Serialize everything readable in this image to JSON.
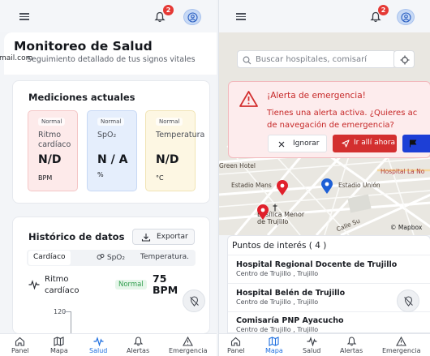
{
  "topbar": {
    "notification_count": "2"
  },
  "screen_a": {
    "page_title": "Monitoreo de Salud",
    "subtitle": "Seguimiento detallado de tus signos vitales",
    "email_fragment": "mail.com",
    "current_measurements": {
      "title": "Mediciones actuales",
      "metrics": [
        {
          "status": "Normal",
          "label": "Ritmo cardíaco",
          "value": "N/D",
          "unit": "BPM",
          "bg": "#fdeaea",
          "border": "#f4c6c6"
        },
        {
          "status": "Normal",
          "label": "SpO₂",
          "value": "N / A",
          "unit": "%",
          "bg": "#e5eefc",
          "border": "#c7d8f4"
        },
        {
          "status": "Normal",
          "label": "Temperatura",
          "value": "N/D",
          "unit": "°C",
          "bg": "#fdf7e3",
          "border": "#f1e4b4"
        }
      ]
    },
    "history": {
      "title": "Histórico de datos",
      "export_label": "Exportar",
      "tabs": [
        "Cardíaco",
        "SpO₂",
        "Temperatura."
      ],
      "heart_label_line1": "Ritmo",
      "heart_label_line2": "cardíaco",
      "status": "Normal",
      "value_line1": "75",
      "value_line2": "BPM",
      "y_tick": "120"
    }
  },
  "screen_b": {
    "search_placeholder": "Buscar hospitales, comisarí",
    "alert": {
      "title": "¡Alerta de emergencia!",
      "message_line1": "Tienes una alerta activa. ¿Quieres ac",
      "message_line2": "de navegación de emergencia?",
      "ignore_label": "Ignorar",
      "go_label": "Ir allí ahora"
    },
    "map_labels": {
      "green_hotel": "Green Hotel",
      "hospital_la_no": "Hospital La No",
      "estadio_mansiche": "Estadio Mans",
      "estadio_union": "Estadio Unión",
      "basilica_1": "Basílica Menor",
      "basilica_2": "de Trujillo",
      "calle_sus": "Calle Su",
      "attribution": "© Mapbox"
    },
    "poi": {
      "title": "Puntos de interés ( 4 )",
      "items": [
        {
          "name": "Hospital Regional Docente de Trujillo",
          "address": "Centro de Trujillo , Trujillo"
        },
        {
          "name": "Hospital Belén de Trujillo",
          "address": "Centro de Trujillo , Trujillo"
        },
        {
          "name": "Comisaría PNP Ayacucho",
          "address": "Centro de Trujillo , Trujillo"
        }
      ]
    }
  },
  "bottom_nav": [
    "Panel",
    "Mapa",
    "Salud",
    "Alertas",
    "Emergencia"
  ],
  "colors": {
    "accent": "#1e6fe0",
    "danger": "#d32f2f",
    "navy": "#1d3fd6"
  }
}
